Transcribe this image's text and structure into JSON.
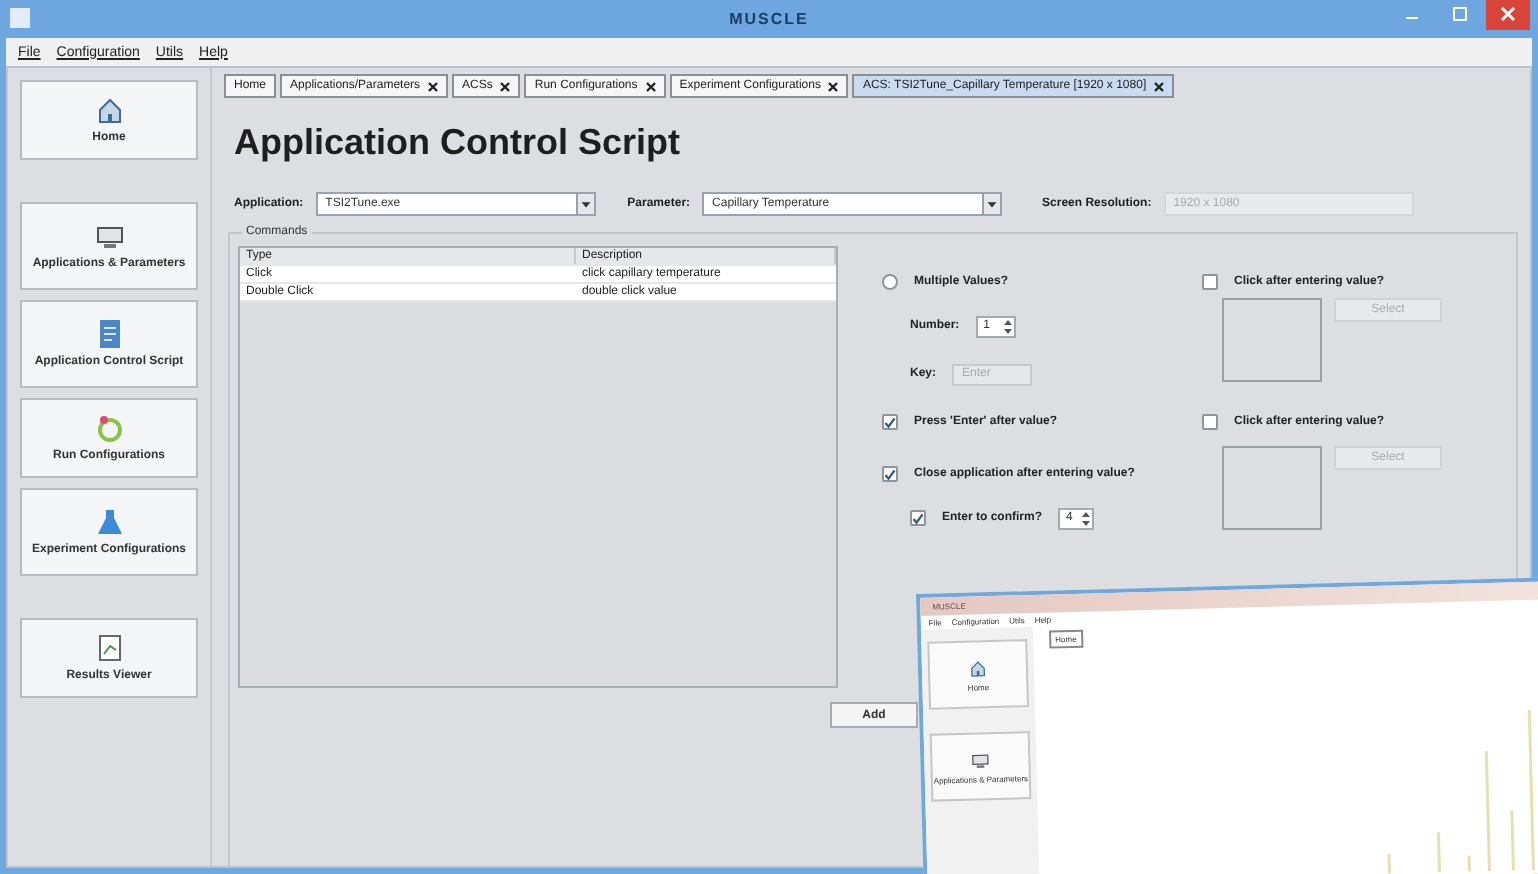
{
  "window": {
    "title": "MUSCLE"
  },
  "menu": [
    "File",
    "Configuration",
    "Utils",
    "Help"
  ],
  "sidebar": [
    {
      "label": "Home",
      "kind": "home",
      "selected": false
    },
    {
      "label": "Applications & Parameters",
      "kind": "apps",
      "selected": false
    },
    {
      "label": "Application Control Script",
      "kind": "script",
      "selected": false
    },
    {
      "label": "Run Configurations",
      "kind": "run",
      "selected": false
    },
    {
      "label": "Experiment Configurations",
      "kind": "flask",
      "selected": false
    },
    {
      "label": "Results Viewer",
      "kind": "results",
      "selected": false
    }
  ],
  "tabs": [
    {
      "label": "Home",
      "closable": false,
      "selected": false
    },
    {
      "label": "Applications/Parameters",
      "closable": true,
      "selected": false
    },
    {
      "label": "ACSs",
      "closable": true,
      "selected": false
    },
    {
      "label": "Run Configurations",
      "closable": true,
      "selected": false
    },
    {
      "label": "Experiment Configurations",
      "closable": true,
      "selected": false
    },
    {
      "label": "ACS: TSI2Tune_Capillary Temperature [1920 x 1080]",
      "closable": true,
      "selected": true
    }
  ],
  "heading": "Application Control Script",
  "form": {
    "application": {
      "label": "Application:",
      "value": "TSI2Tune.exe"
    },
    "parameter": {
      "label": "Parameter:",
      "value": "Capillary Temperature"
    },
    "resolution": {
      "label": "Screen Resolution:",
      "value": "1920 x 1080",
      "disabled": true
    }
  },
  "commands": {
    "title": "Commands",
    "columns": [
      "Type",
      "Description"
    ],
    "rows": [
      {
        "cells": [
          "Click",
          "click capillary temperature"
        ],
        "selected": false
      },
      {
        "cells": [
          "Double Click",
          "double click value"
        ],
        "selected": false
      }
    ],
    "add_button": "Add"
  },
  "options": {
    "multiple_values": {
      "label": "Multiple Values?",
      "checked": false
    },
    "click_after_first": {
      "label": "Click after entering value?",
      "checked": false
    },
    "number": {
      "label": "Number:",
      "value": "1"
    },
    "key": {
      "label": "Key:",
      "value": "Enter",
      "disabled": true
    },
    "select_first": {
      "label": "Select",
      "disabled": true
    },
    "press_enter": {
      "label": "Press 'Enter' after value?",
      "checked": true
    },
    "click_after_second": {
      "label": "Click after entering value?",
      "checked": false
    },
    "close_app": {
      "label": "Close application after entering value?",
      "checked": true
    },
    "select_second": {
      "label": "Select",
      "disabled": true
    },
    "enter_confirm": {
      "label": "Enter to confirm?",
      "checked": true,
      "value": "4"
    }
  },
  "overlay_window": {
    "title": "MUSCLE",
    "menu": [
      "File",
      "Configuration",
      "Utils",
      "Help"
    ],
    "tabs": [
      "Home"
    ],
    "sidebar": [
      {
        "label": "Home",
        "kind": "home"
      },
      {
        "label": "Applications & Parameters",
        "kind": "apps"
      }
    ]
  }
}
